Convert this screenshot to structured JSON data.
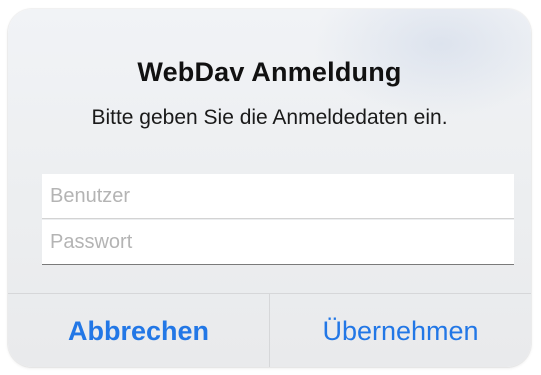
{
  "dialog": {
    "title": "WebDav Anmeldung",
    "message": "Bitte geben Sie die Anmeldedaten ein.",
    "fields": {
      "username": {
        "value": "",
        "placeholder": "Benutzer"
      },
      "password": {
        "value": "",
        "placeholder": "Passwort"
      }
    },
    "buttons": {
      "cancel_label": "Abbrechen",
      "confirm_label": "Übernehmen"
    }
  },
  "colors": {
    "accent": "#2277e6",
    "dialog_background": "#eceef0",
    "separator": "#d6d7d9"
  }
}
